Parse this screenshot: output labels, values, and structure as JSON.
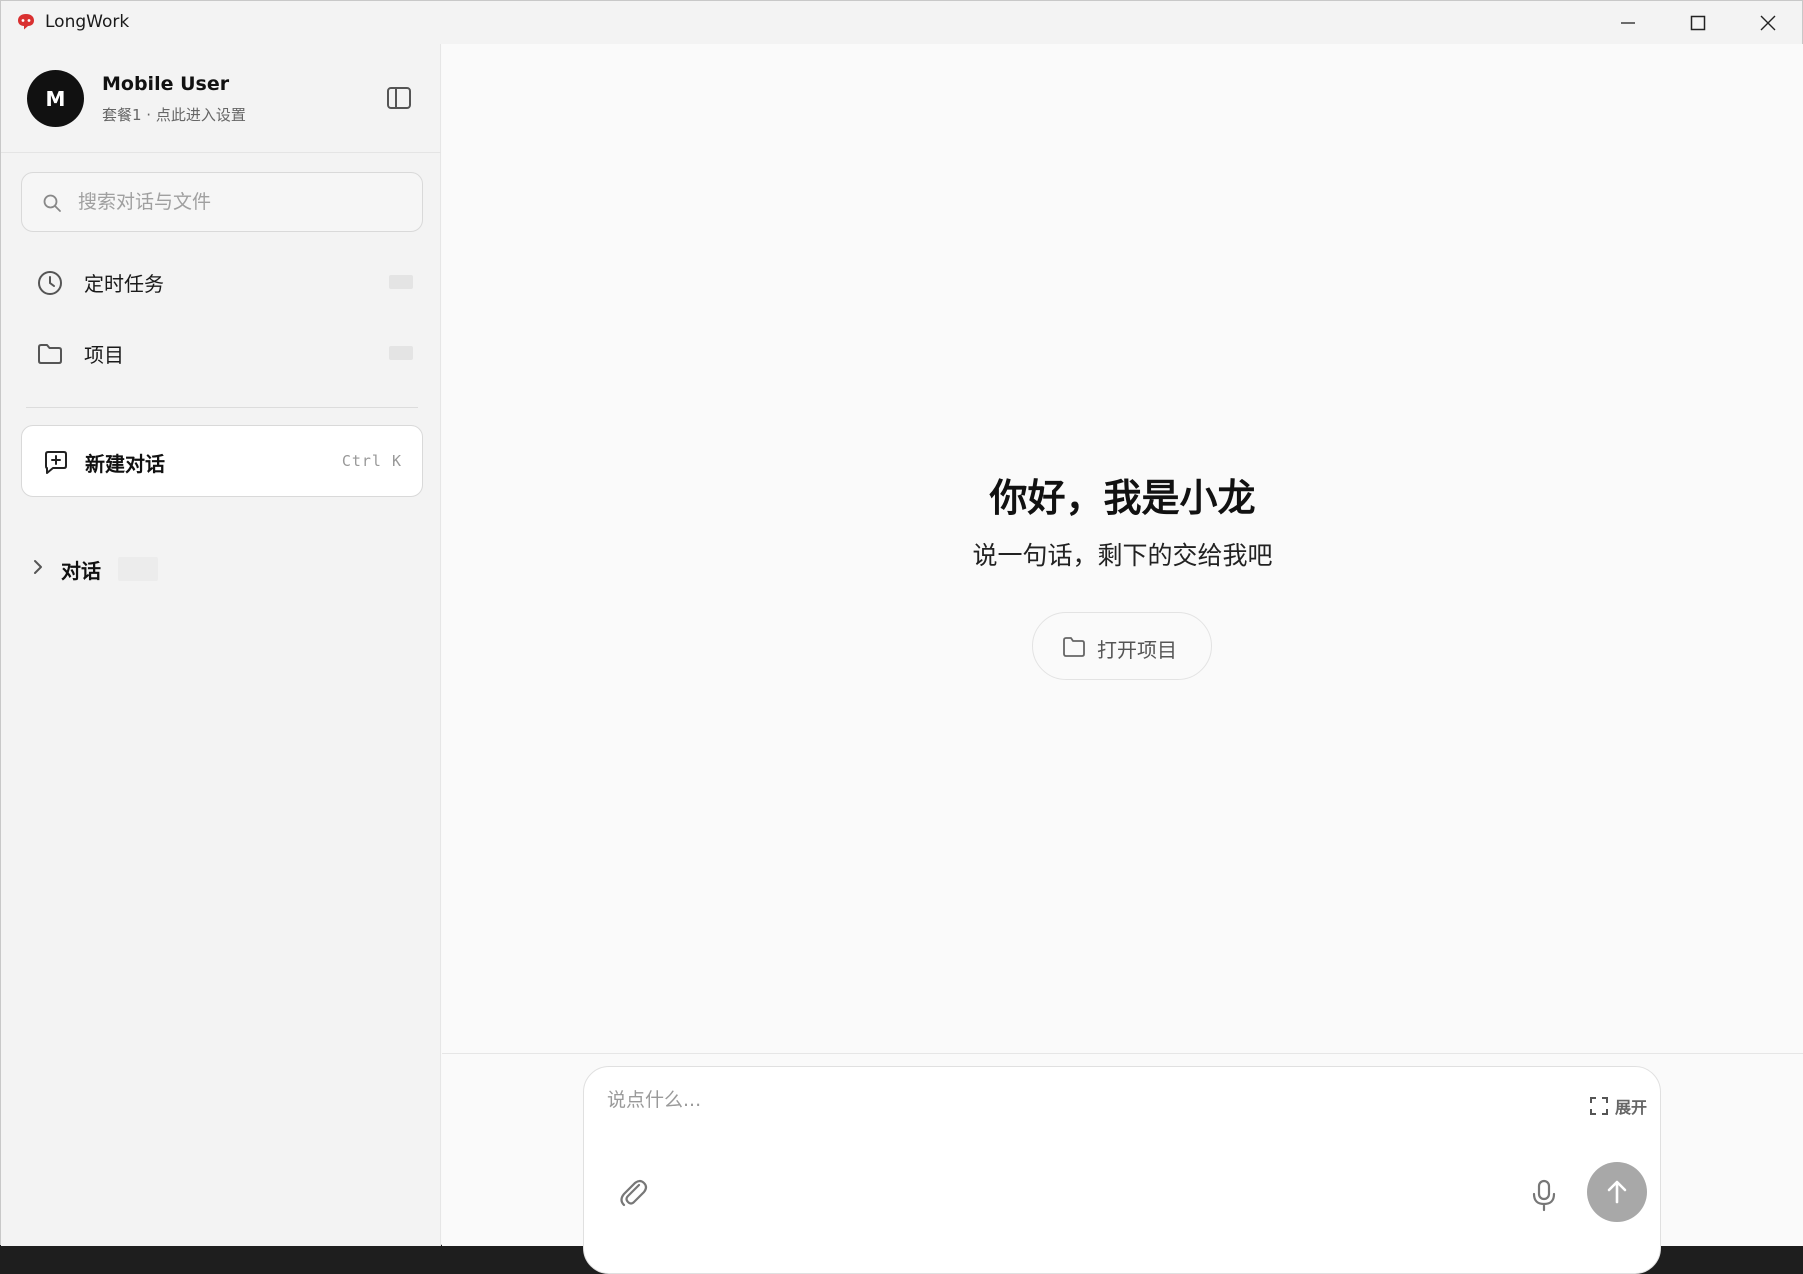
{
  "window": {
    "title": "LongWork",
    "logo_icon": "longwork-logo-icon",
    "accent_color": "#d93030",
    "controls": [
      "minimize-icon",
      "maximize-icon",
      "close-icon"
    ]
  },
  "sidebar": {
    "profile": {
      "avatar_letter": "M",
      "name": "Mobile User",
      "subtitle": "套餐1 · 点此进入设置"
    },
    "toggle_icon": "sidebar-toggle-icon",
    "search": {
      "placeholder": "搜索对话与文件",
      "icon": "search-icon"
    },
    "nav": [
      {
        "label": "定时任务",
        "icon": "clock-icon"
      },
      {
        "label": "项目",
        "icon": "folder-icon"
      }
    ],
    "new_chat": {
      "label": "新建对话",
      "shortcut": "Ctrl K",
      "icon": "new-chat-icon"
    },
    "conversations": {
      "label": "对话",
      "icon": "chevron-right-icon"
    }
  },
  "main": {
    "greeting_title": "你好，我是小龙",
    "greeting_subtitle": "说一句话，剩下的交给我吧",
    "open_project_label": "打开项目",
    "composer": {
      "placeholder": "说点什么...",
      "expand_label": "展开",
      "send_color": "#a8a8a8"
    }
  }
}
